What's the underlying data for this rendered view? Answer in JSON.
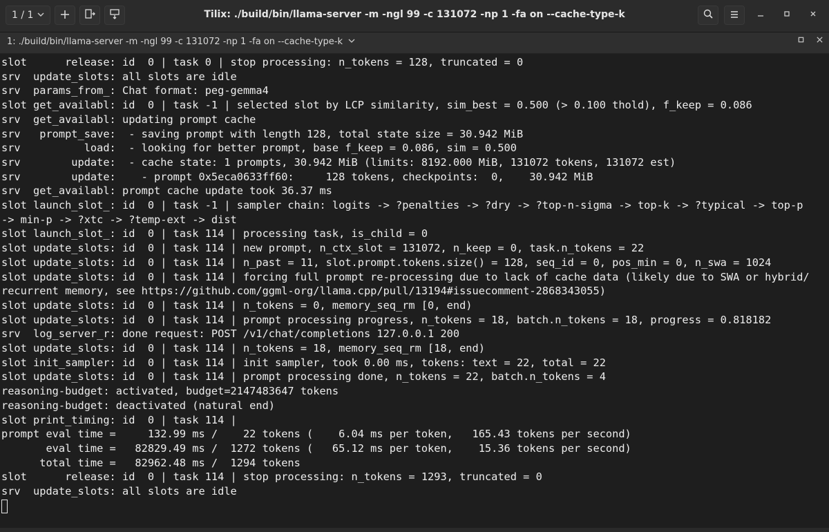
{
  "titlebar": {
    "session": "1 / 1",
    "title": "Tilix: ./build/bin/llama-server -m  -ngl 99 -c 131072 -np 1 -fa on --cache-type-k",
    "icons": [
      "chevron-down-icon",
      "plus-icon",
      "split-right-icon",
      "split-down-icon",
      "search-icon",
      "hamburger-menu-icon",
      "minimize-icon",
      "maximize-icon",
      "close-icon"
    ]
  },
  "tab": {
    "label": "1: ./build/bin/llama-server -m  -ngl 99 -c 131072 -np 1 -fa on --cache-type-k"
  },
  "terminal": {
    "lines": [
      "slot      release: id  0 | task 0 | stop processing: n_tokens = 128, truncated = 0",
      "srv  update_slots: all slots are idle",
      "srv  params_from_: Chat format: peg-gemma4",
      "slot get_availabl: id  0 | task -1 | selected slot by LCP similarity, sim_best = 0.500 (> 0.100 thold), f_keep = 0.086",
      "srv  get_availabl: updating prompt cache",
      "srv   prompt_save:  - saving prompt with length 128, total state size = 30.942 MiB",
      "srv          load:  - looking for better prompt, base f_keep = 0.086, sim = 0.500",
      "srv        update:  - cache state: 1 prompts, 30.942 MiB (limits: 8192.000 MiB, 131072 tokens, 131072 est)",
      "srv        update:    - prompt 0x5eca0633ff60:     128 tokens, checkpoints:  0,    30.942 MiB",
      "srv  get_availabl: prompt cache update took 36.37 ms",
      "slot launch_slot_: id  0 | task -1 | sampler chain: logits -> ?penalties -> ?dry -> ?top-n-sigma -> top-k -> ?typical -> top-p",
      "-> min-p -> ?xtc -> ?temp-ext -> dist",
      "slot launch_slot_: id  0 | task 114 | processing task, is_child = 0",
      "slot update_slots: id  0 | task 114 | new prompt, n_ctx_slot = 131072, n_keep = 0, task.n_tokens = 22",
      "slot update_slots: id  0 | task 114 | n_past = 11, slot.prompt.tokens.size() = 128, seq_id = 0, pos_min = 0, n_swa = 1024",
      "slot update_slots: id  0 | task 114 | forcing full prompt re-processing due to lack of cache data (likely due to SWA or hybrid/",
      "recurrent memory, see https://github.com/ggml-org/llama.cpp/pull/13194#issuecomment-2868343055)",
      "slot update_slots: id  0 | task 114 | n_tokens = 0, memory_seq_rm [0, end)",
      "slot update_slots: id  0 | task 114 | prompt processing progress, n_tokens = 18, batch.n_tokens = 18, progress = 0.818182",
      "srv  log_server_r: done request: POST /v1/chat/completions 127.0.0.1 200",
      "slot update_slots: id  0 | task 114 | n_tokens = 18, memory_seq_rm [18, end)",
      "slot init_sampler: id  0 | task 114 | init sampler, took 0.00 ms, tokens: text = 22, total = 22",
      "slot update_slots: id  0 | task 114 | prompt processing done, n_tokens = 22, batch.n_tokens = 4",
      "reasoning-budget: activated, budget=2147483647 tokens",
      "reasoning-budget: deactivated (natural end)",
      "slot print_timing: id  0 | task 114 |",
      "prompt eval time =     132.99 ms /    22 tokens (    6.04 ms per token,   165.43 tokens per second)",
      "       eval time =   82829.49 ms /  1272 tokens (   65.12 ms per token,    15.36 tokens per second)",
      "      total time =   82962.48 ms /  1294 tokens",
      "slot      release: id  0 | task 114 | stop processing: n_tokens = 1293, truncated = 0",
      "srv  update_slots: all slots are idle"
    ]
  }
}
